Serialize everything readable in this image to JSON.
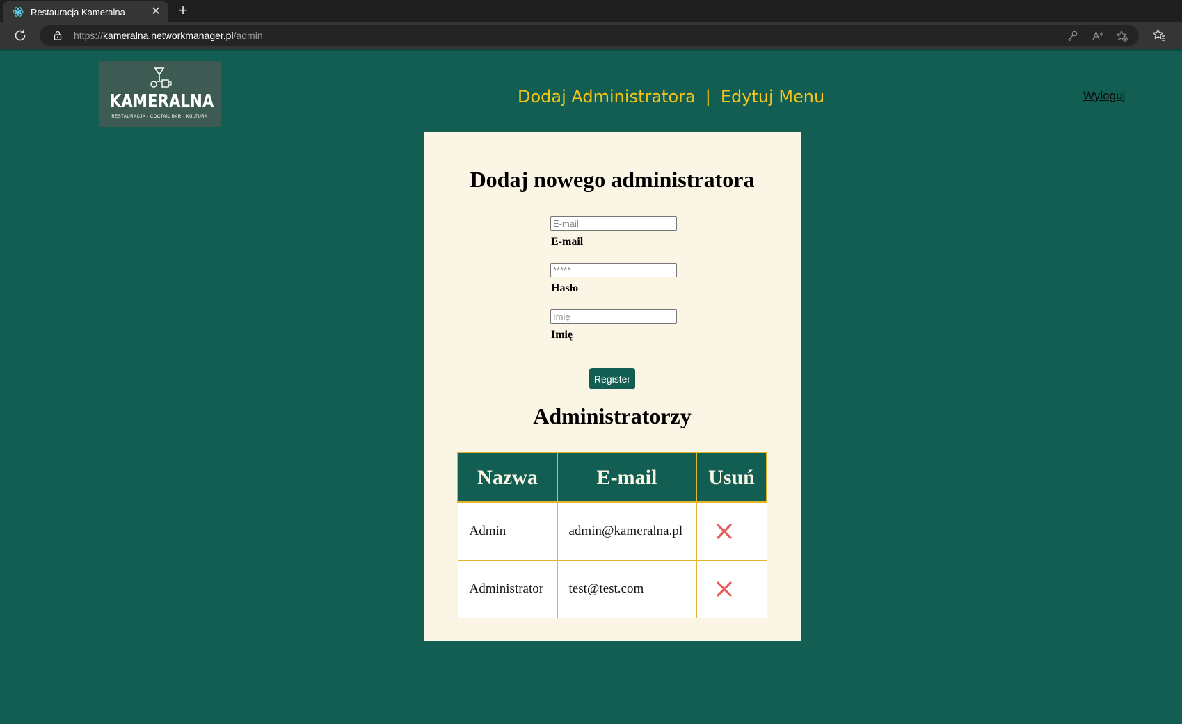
{
  "browser": {
    "tab_title": "Restauracja Kameralna",
    "close_glyph": "✕",
    "new_tab_glyph": "+",
    "url_scheme": "https://",
    "url_host": "kameralna.networkmanager.pl",
    "url_path": "/admin"
  },
  "header": {
    "logo_text": "KAMERALNA",
    "logo_subtitle": "RESTAURACJA · COCTAIL BAR · KULTURA",
    "nav": {
      "add_admin": "Dodaj Administratora",
      "separator": "|",
      "edit_menu": "Edytuj Menu"
    },
    "logout": "Wyloguj"
  },
  "form": {
    "title": "Dodaj nowego administratora",
    "email_placeholder": "E-mail",
    "email_label": "E-mail",
    "password_placeholder": "*****",
    "password_label": "Hasło",
    "name_placeholder": "Imię",
    "name_label": "Imię",
    "submit_label": "Register"
  },
  "admins": {
    "title": "Administratorzy",
    "columns": [
      "Nazwa",
      "E-mail",
      "Usuń"
    ],
    "rows": [
      {
        "name": "Admin",
        "email": "admin@kameralna.pl"
      },
      {
        "name": "Administrator",
        "email": "test@test.com"
      }
    ]
  },
  "colors": {
    "page_background": "#135e52",
    "nav_link": "#f5c518",
    "card_background": "#fbf5e6",
    "table_border": "#e3b52a",
    "delete_icon": "#e85c5c"
  },
  "icons": {
    "favicon": "react-atom-icon",
    "reload": "reload-icon",
    "lock": "lock-icon",
    "address_actions": [
      "key-icon",
      "read-aloud-icon",
      "add-favorite-icon"
    ],
    "favorites": "favorites-icon",
    "delete": "delete-x-icon"
  }
}
